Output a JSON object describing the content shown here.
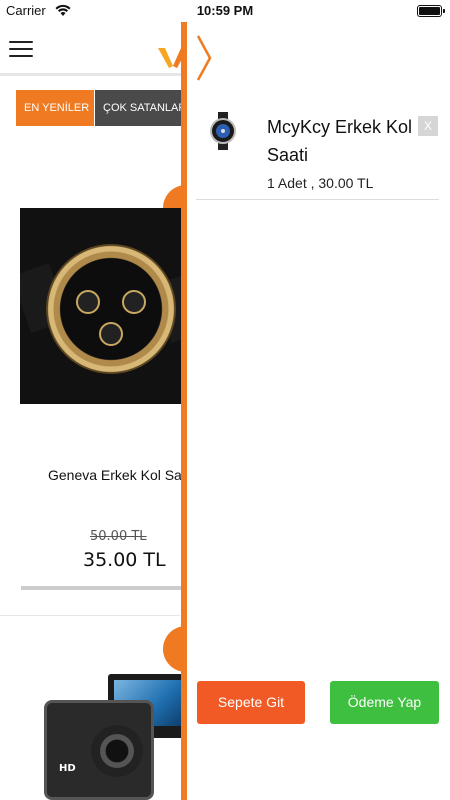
{
  "status_bar": {
    "carrier": "Carrier",
    "time": "10:59 PM"
  },
  "header": {
    "menu_icon": "hamburger-icon",
    "logo_icon": "brand-logo-icon"
  },
  "tabs": [
    {
      "label": "EN YENİLER"
    },
    {
      "label": "ÇOK SATANLAR"
    }
  ],
  "products": [
    {
      "name": "Geneva Erkek Kol Saati",
      "old_price": "50.00 TL",
      "price": "35.00 TL"
    },
    {
      "name": "",
      "image_icon": "action-camera-icon"
    }
  ],
  "drawer": {
    "close_icon": "chevron-right-icon",
    "cart_items": [
      {
        "name": "McyKcy Erkek Kol Saati",
        "quantity_text": "1 Adet , 30.00 TL",
        "remove_label": "X"
      }
    ],
    "go_to_cart_label": "Sepete Git",
    "checkout_label": "Ödeme Yap"
  },
  "colors": {
    "accent": "#f07a21",
    "go_to_cart": "#f15a24",
    "checkout": "#3fbf3f",
    "tab_dark": "#4a4a4a"
  }
}
